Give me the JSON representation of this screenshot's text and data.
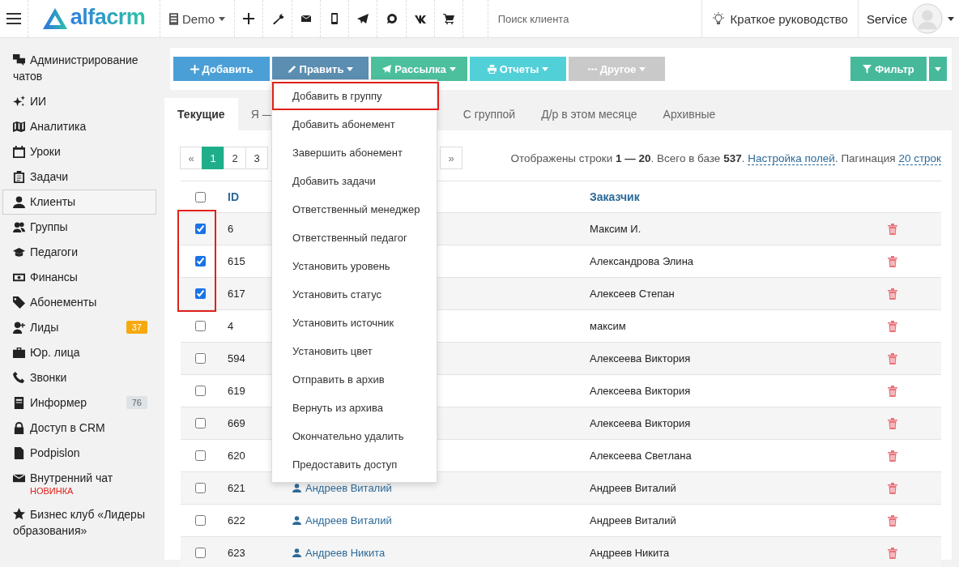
{
  "header": {
    "logo_text": "alfacrm",
    "company": "Demo",
    "search": {
      "placeholder": "Поиск клиента"
    },
    "guide": "Краткое руководство",
    "user": "Service"
  },
  "sidebar": {
    "items": [
      {
        "label": "Администрирование чатов",
        "selected": false
      },
      {
        "label": "ИИ",
        "selected": false
      },
      {
        "label": "Аналитика",
        "selected": false
      },
      {
        "label": "Уроки",
        "selected": false
      },
      {
        "label": "Задачи",
        "selected": false
      },
      {
        "label": "Клиенты",
        "selected": true
      },
      {
        "label": "Группы",
        "selected": false
      },
      {
        "label": "Педагоги",
        "selected": false
      },
      {
        "label": "Финансы",
        "selected": false
      },
      {
        "label": "Абонементы",
        "selected": false
      },
      {
        "label": "Лиды",
        "selected": false,
        "badge": {
          "text": "37",
          "color": "#f6a90f"
        }
      },
      {
        "label": "Юр. лица",
        "selected": false
      },
      {
        "label": "Звонки",
        "selected": false
      },
      {
        "label": "Информер",
        "selected": false,
        "badge": {
          "text": "76",
          "color": "#dde3e6"
        }
      },
      {
        "label": "Доступ в CRM",
        "selected": false
      },
      {
        "label": "Podpislon",
        "selected": false
      },
      {
        "label": "Внутренний чат",
        "selected": false,
        "note": "НОВИНКА"
      },
      {
        "label": "Бизнес клуб «Лидеры образования»",
        "selected": false
      }
    ]
  },
  "toolbar": {
    "buttons": [
      {
        "label": "Добавить",
        "color": "#4a9fd6",
        "dropdown": false
      },
      {
        "label": "Править",
        "color": "#5b8eb1",
        "dropdown": true
      },
      {
        "label": "Рассылка",
        "color": "#4cbf9d",
        "dropdown": true
      },
      {
        "label": "Отчеты",
        "color": "#52d0d8",
        "dropdown": true
      },
      {
        "label": "Другое",
        "color": "#c9c9c9",
        "dropdown": true
      }
    ],
    "filter": {
      "label": "Фильтр",
      "color": "#46b99b"
    }
  },
  "tabs": [
    {
      "label": "Текущие",
      "selected": true
    },
    {
      "label": "Я —",
      "selected": false
    },
    {
      "label": "С группой",
      "selected": false
    },
    {
      "label": "Д/р в этом месяце",
      "selected": false
    },
    {
      "label": "Архивные",
      "selected": false
    }
  ],
  "pagination": {
    "prev": "«",
    "pages": [
      {
        "label": "1",
        "selected": true
      },
      {
        "label": "2",
        "selected": false
      },
      {
        "label": "3",
        "selected": false
      }
    ],
    "next": "»"
  },
  "info": [
    {
      "text": "Отображены строки **1 — 20**. Всего в базе **537**."
    },
    {
      "link": "Настройка полей"
    },
    {
      "text": ". Пагинация"
    },
    {
      "link": "20 строк"
    }
  ],
  "table": {
    "select_all_checked": false,
    "columns": [
      "ID",
      "Заказчик"
    ],
    "rows": [
      {
        "id": "6",
        "customer": "Максим И.",
        "checked": true,
        "highlighted": true
      },
      {
        "id": "615",
        "customer": "Александрова Элина",
        "checked": true,
        "highlighted": true
      },
      {
        "id": "617",
        "customer": "Алексеев Степан",
        "checked": true,
        "highlighted": true
      },
      {
        "id": "4",
        "customer": "максим",
        "checked": false,
        "highlighted": false
      },
      {
        "id": "594",
        "customer": "Алексеева Виктория",
        "checked": false,
        "highlighted": false
      },
      {
        "id": "619",
        "customer": "Алексеева Виктория",
        "checked": false,
        "highlighted": false
      },
      {
        "id": "669",
        "customer": "Алексеева Виктория",
        "checked": false,
        "highlighted": false
      },
      {
        "id": "620",
        "customer": "Алексеева Светлана",
        "checked": false,
        "highlighted": false
      },
      {
        "id": "621",
        "client": "Андреев Виталий",
        "customer": "Андреев Виталий",
        "checked": false,
        "highlighted": false
      },
      {
        "id": "622",
        "client": "Андреев Виталий",
        "customer": "Андреев Виталий",
        "checked": false,
        "highlighted": false
      },
      {
        "id": "623",
        "client": "Андреев Никита",
        "customer": "Андреев Никита",
        "checked": false,
        "highlighted": false
      }
    ]
  },
  "menu": {
    "items": [
      {
        "label": "Добавить в группу",
        "highlighted": true
      },
      {
        "label": "Добавить абонемент",
        "highlighted": false
      },
      {
        "label": "Завершить абонемент",
        "highlighted": false
      },
      {
        "label": "Добавить задачи",
        "highlighted": false
      },
      {
        "label": "Ответственный менеджер",
        "highlighted": false
      },
      {
        "label": "Ответственный педагог",
        "highlighted": false
      },
      {
        "label": "Установить уровень",
        "highlighted": false
      },
      {
        "label": "Установить статус",
        "highlighted": false
      },
      {
        "label": "Установить источник",
        "highlighted": false
      },
      {
        "label": "Установить цвет",
        "highlighted": false
      },
      {
        "label": "Отправить в архив",
        "highlighted": false
      },
      {
        "label": "Вернуть из архива",
        "highlighted": false
      },
      {
        "label": "Окончательно удалить",
        "highlighted": false
      },
      {
        "label": "Предоставить доступ",
        "highlighted": false
      }
    ]
  }
}
